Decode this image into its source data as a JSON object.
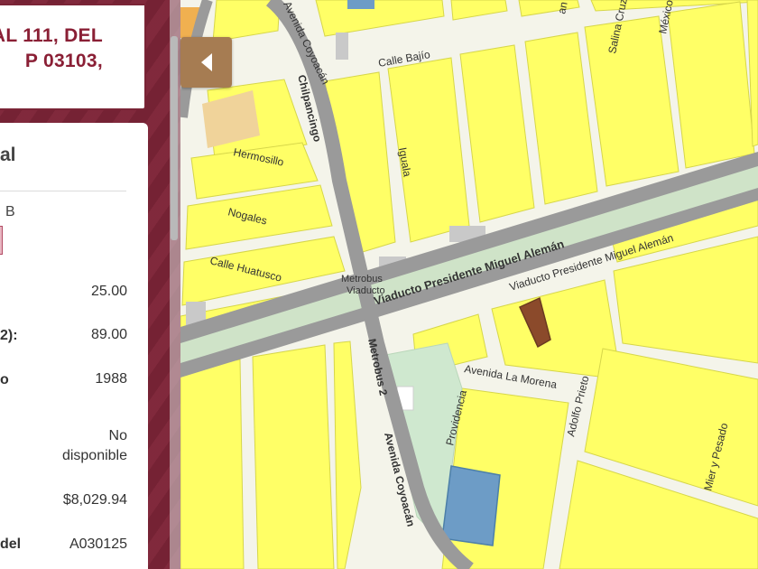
{
  "panel": {
    "address": {
      "line1": "AL 111, DEL",
      "line2": "P 03103,"
    },
    "card_title": "al",
    "section_label": "B",
    "rows": [
      {
        "label": "",
        "value": "25.00"
      },
      {
        "label": "2):",
        "value": "89.00"
      },
      {
        "label": "o",
        "value": "1988"
      },
      {
        "label": "",
        "value": "No disponible",
        "value_line1": "No",
        "value_line2": "disponible"
      },
      {
        "label": "",
        "value": "$8,029.94"
      },
      {
        "label": "del",
        "value": "A030125"
      }
    ]
  },
  "map": {
    "collapse_button_icon": "chevron-left-icon",
    "streets": {
      "calle_bajio": "Calle Bajío",
      "hermosillo": "Hermosillo",
      "nogales": "Nogales",
      "calle_huatusco": "Calle Huatusco",
      "iguala": "Iguala",
      "chilpancingo": "Chilpancingo",
      "avenida_coyoacan_top": "Avenida Coyoacán",
      "avenida_coyoacan_bottom": "Avenida Coyoacán",
      "viaducto_1": "Viaducto Presidente Miguel Alemán",
      "viaducto_2": "Viaducto Presidente Miguel Alemán",
      "metrobus_viaducto_1": "Metrobus",
      "metrobus_viaducto_2": "Viaducto",
      "metrobus_2": "Metrobus 2",
      "avenida_la_morena": "Avenida La Morena",
      "providencia": "Providencia",
      "adolfo_prieto": "Adolfo Prieto",
      "mier_y_pesado": "Mier y Pesado",
      "salina_cruz": "Salina Cruz",
      "mexico": "México",
      "an": "an"
    },
    "colors": {
      "block": "#ffff66",
      "block_outline": "#d6d64a",
      "road": "#9a9a9a",
      "street_bg": "#f4f4ea",
      "highlight_parcel": "#8b4a2b",
      "blue_parcel": "#6d9cc6",
      "park": "#cfe8cf",
      "orange_parcel": "#f0d39a",
      "panel_bg": "#7a2436",
      "button": "#a67c52"
    }
  }
}
